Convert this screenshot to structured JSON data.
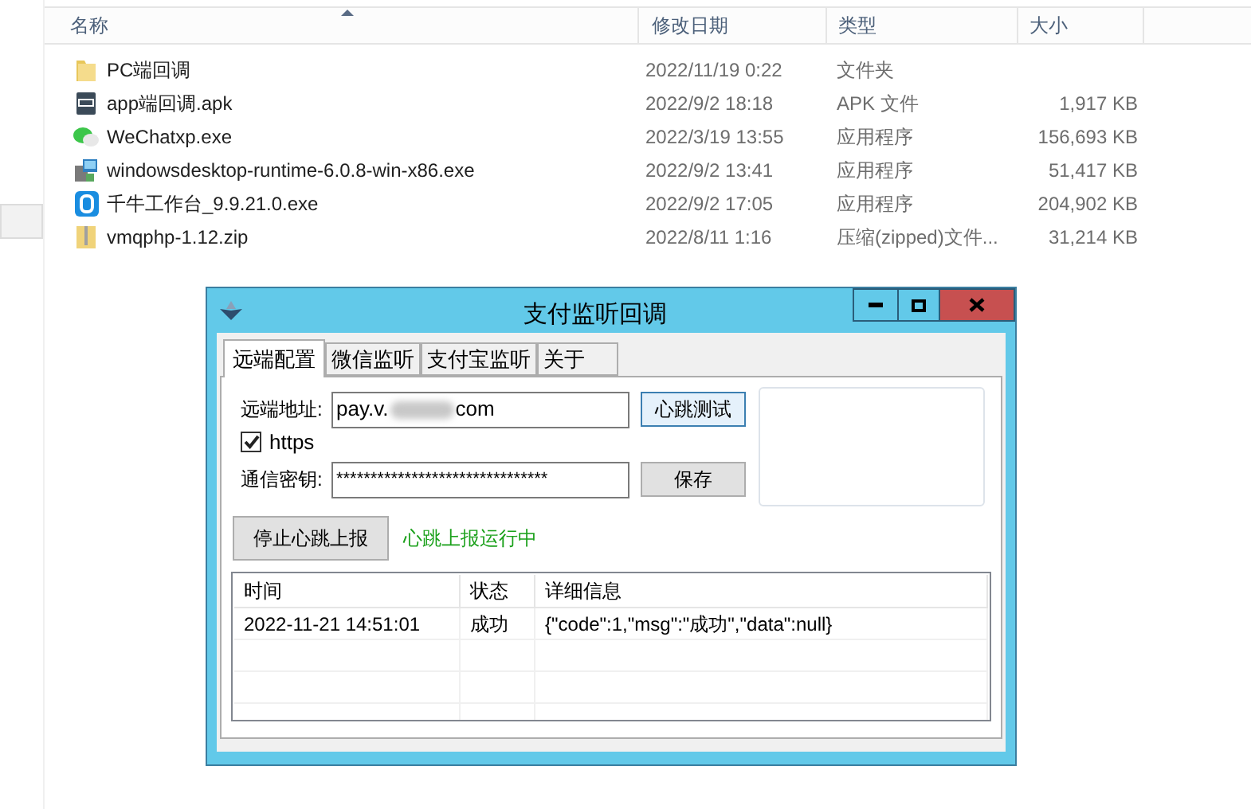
{
  "explorer": {
    "columns": [
      {
        "label": "名称",
        "sorted": true
      },
      {
        "label": "修改日期",
        "sorted": false
      },
      {
        "label": "类型",
        "sorted": false
      },
      {
        "label": "大小",
        "sorted": false
      }
    ],
    "files": [
      {
        "kind": "folder",
        "name": "PC端回调",
        "modified": "2022/11/19 0:22",
        "type": "文件夹"
      },
      {
        "kind": "apk",
        "name": "app端回调.apk",
        "modified": "2022/9/2 18:18",
        "type": "APK 文件",
        "size": "1,917 KB"
      },
      {
        "kind": "wechat",
        "name": "WeChatxp.exe",
        "modified": "2022/3/19 13:55",
        "type": "应用程序",
        "size": "156,693 KB"
      },
      {
        "kind": "installer",
        "name": "windowsdesktop-runtime-6.0.8-win-x86.exe",
        "modified": "2022/9/2 13:41",
        "type": "应用程序",
        "size": "51,417 KB"
      },
      {
        "kind": "app",
        "name": "千牛工作台_9.9.21.0.exe",
        "modified": "2022/9/2 17:05",
        "type": "应用程序",
        "size": "204,902 KB"
      },
      {
        "kind": "zip",
        "name": "vmqphp-1.12.zip",
        "modified": "2022/8/11 1:16",
        "type": "压缩(zipped)文件...",
        "size": "31,214 KB"
      }
    ]
  },
  "dialog": {
    "title": "支付监听回调",
    "tabs": [
      {
        "label": "远端配置",
        "selected": true
      },
      {
        "label": "微信监听",
        "selected": false
      },
      {
        "label": "支付宝监听",
        "selected": false
      },
      {
        "label": "关于",
        "selected": false
      }
    ],
    "address": {
      "label": "远端地址:",
      "value_start": "pay.v.",
      "value_end": "com"
    },
    "https": {
      "label": "https",
      "checked": true
    },
    "secret": {
      "label": "通信密钥:",
      "value": "*******************************"
    },
    "test_button": "心跳测试",
    "save_button": "保存",
    "stop_button": "停止心跳上报",
    "status": "心跳上报运行中",
    "log": {
      "columns": [
        "时间",
        "状态",
        "详细信息"
      ],
      "rows": [
        [
          "2022-11-21 14:51:01",
          "成功",
          "{\"code\":1,\"msg\":\"成功\",\"data\":null}"
        ]
      ]
    }
  }
}
